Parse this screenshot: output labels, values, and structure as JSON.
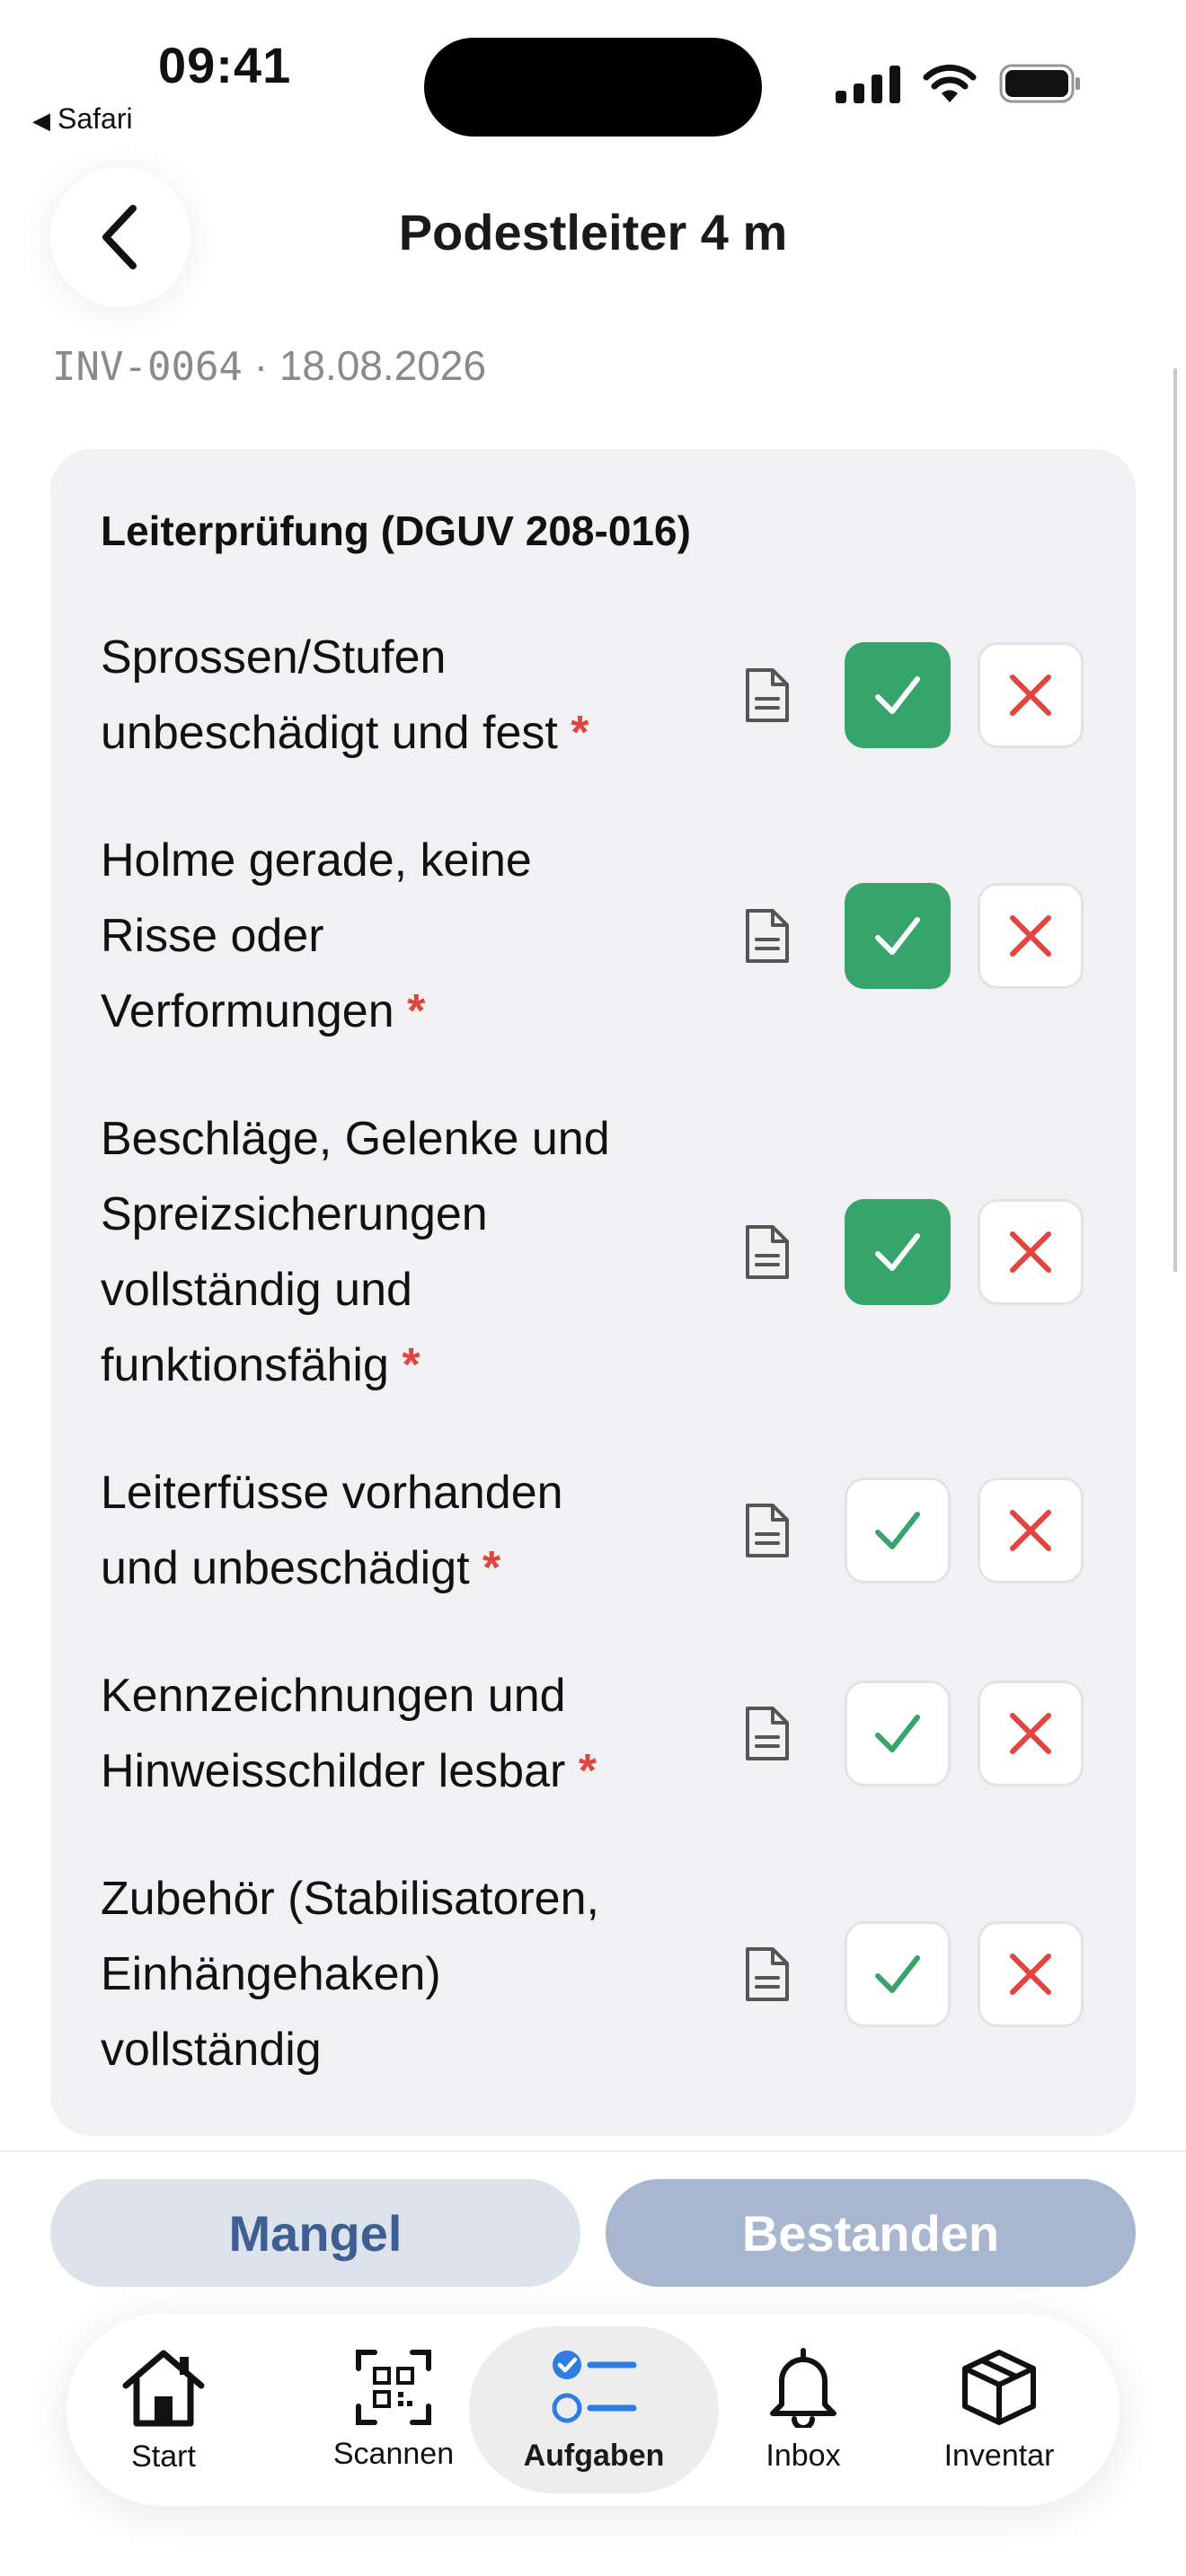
{
  "status_bar": {
    "time": "09:41",
    "back_app": "Safari",
    "icons": [
      "signal-icon",
      "wifi-icon",
      "battery-icon"
    ]
  },
  "header": {
    "title": "Podestleiter 4 m",
    "back_icon": "chevron-left-icon",
    "inventory_id": "INV-0064",
    "separator": "·",
    "date": "18.08.2026"
  },
  "checklist": {
    "title": "Leiterprüfung (DGUV 208-016)",
    "required_marker": "*",
    "items": [
      {
        "lines": [
          "Sprossen/Stufen",
          "unbeschädigt und fest"
        ],
        "required": true,
        "status": "ok"
      },
      {
        "lines": [
          "Holme gerade, keine",
          "Risse oder",
          "Verformungen"
        ],
        "required": true,
        "status": "ok"
      },
      {
        "lines": [
          "Beschläge, Gelenke und",
          "Spreizsicherungen",
          "vollständig und",
          "funktionsfähig"
        ],
        "required": true,
        "status": "ok"
      },
      {
        "lines": [
          "Leiterfüsse vorhanden",
          "und unbeschädigt"
        ],
        "required": true,
        "status": "none"
      },
      {
        "lines": [
          "Kennzeichnungen und",
          "Hinweisschilder lesbar"
        ],
        "required": true,
        "status": "none"
      },
      {
        "lines": [
          "Zubehör (Stabilisatoren,",
          "Einhängehaken)",
          "vollständig"
        ],
        "required": false,
        "status": "none"
      }
    ]
  },
  "actions": {
    "defect_label": "Mangel",
    "pass_label": "Bestanden"
  },
  "tabbar": {
    "active": "Aufgaben",
    "tabs": [
      {
        "label": "Start",
        "icon": "home-icon"
      },
      {
        "label": "Scannen",
        "icon": "qr-scan-icon"
      },
      {
        "label": "Aufgaben",
        "icon": "task-list-icon"
      },
      {
        "label": "Inbox",
        "icon": "bell-icon"
      },
      {
        "label": "Inventar",
        "icon": "box-icon"
      }
    ]
  },
  "colors": {
    "ok_active": "#36a46b",
    "fail": "#e0453f",
    "accent": "#2f7de1",
    "card_bg": "#f1f1f3"
  }
}
